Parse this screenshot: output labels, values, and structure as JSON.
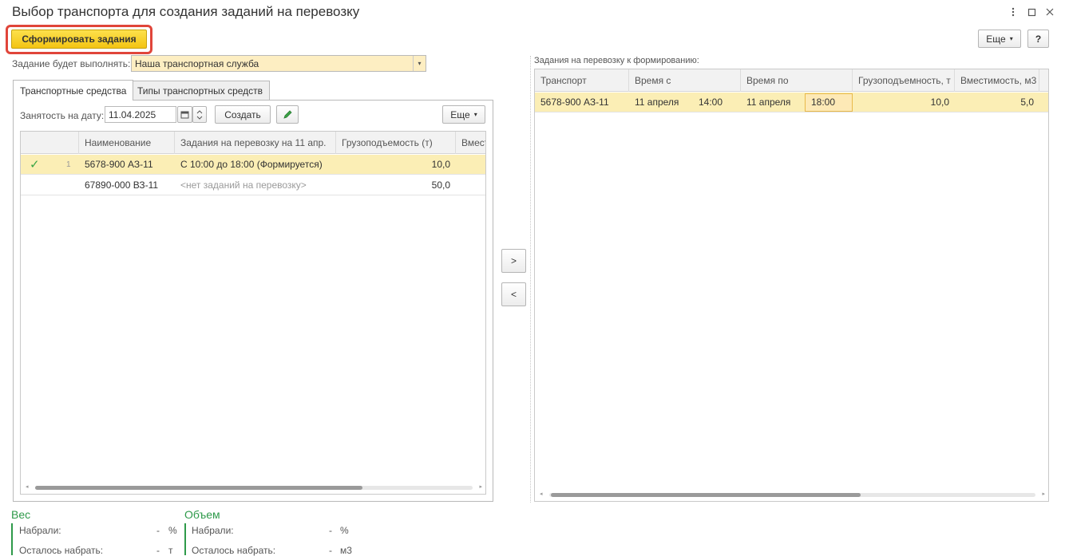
{
  "window": {
    "title": "Выбор транспорта для создания заданий на перевозку"
  },
  "toolbar": {
    "generate_label": "Сформировать задания",
    "more_label": "Еще",
    "help_label": "?"
  },
  "executor": {
    "label": "Задание будет выполнять:",
    "value": "Наша транспортная служба"
  },
  "tabs": [
    {
      "label": "Транспортные средства",
      "active": true
    },
    {
      "label": "Типы транспортных средств",
      "active": false
    }
  ],
  "left_panel": {
    "date_label": "Занятость на дату:",
    "date_value": "11.04.2025",
    "create_label": "Создать",
    "more_label": "Еще",
    "columns": [
      "Наименование",
      "Задания на перевозку на 11 апр.",
      "Грузоподъемость (т)",
      "Вмест"
    ],
    "rows": [
      {
        "index": "1",
        "checked": true,
        "name": "5678-900 АЗ-11",
        "tasks": "С 10:00 до 18:00 (Формируется)",
        "capacity": "10,0",
        "selected": true
      },
      {
        "index": "",
        "checked": false,
        "name": "67890-000 ВЗ-11",
        "tasks": "<нет заданий на перевозку>",
        "capacity": "50,0",
        "selected": false
      }
    ]
  },
  "transfer": {
    "add_label": ">",
    "remove_label": "<"
  },
  "right_panel": {
    "label": "Задания на перевозку к формированию:",
    "columns": [
      "Транспорт",
      "Время с",
      "Время по",
      "Грузоподъемность, т",
      "Вместимость, м3"
    ],
    "rows": [
      {
        "transport": "5678-900 АЗ-11",
        "from_date": "11 апреля",
        "from_time": "14:00",
        "to_date": "11 апреля",
        "to_time": "18:00",
        "capacity": "10,0",
        "volume": "5,0"
      }
    ]
  },
  "weight": {
    "title": "Вес",
    "collected_label": "Набрали:",
    "collected_value": "-",
    "collected_unit": "%",
    "remaining_label": "Осталось набрать:",
    "remaining_value": "-",
    "remaining_unit": "т"
  },
  "volume": {
    "title": "Объем",
    "collected_label": "Набрали:",
    "collected_value": "-",
    "collected_unit": "%",
    "remaining_label": "Осталось набрать:",
    "remaining_value": "-",
    "remaining_unit": "м3"
  },
  "icons": {
    "calendar": "calendar-icon",
    "edit": "pencil-icon",
    "check": "checkmark-icon"
  },
  "colors": {
    "primary_button": "#f3c413",
    "highlight_ring": "#e0453a",
    "selected_row": "#fbeeb5",
    "group_title": "#2e9a4a"
  }
}
